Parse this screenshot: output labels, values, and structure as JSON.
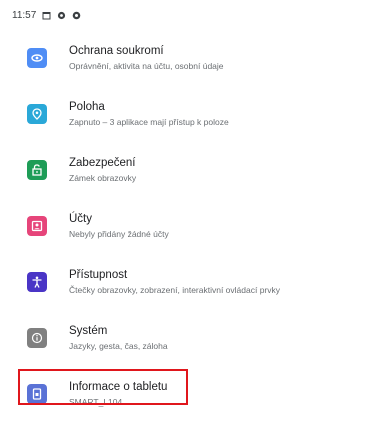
{
  "status_bar": {
    "time": "11:57",
    "icons": [
      "calendar-icon",
      "gear-icon",
      "shield-icon"
    ]
  },
  "settings": {
    "items": [
      {
        "title": "Ochrana soukromí",
        "subtitle": "Oprávnění, aktivita na účtu, osobní údaje",
        "icon": "privacy-icon",
        "color": "#4f8df5"
      },
      {
        "title": "Poloha",
        "subtitle": "Zapnuto – 3 aplikace mají přístup k poloze",
        "icon": "location-icon",
        "color": "#2aa8d8"
      },
      {
        "title": "Zabezpečení",
        "subtitle": "Zámek obrazovky",
        "icon": "lock-icon",
        "color": "#1e9d57"
      },
      {
        "title": "Účty",
        "subtitle": "Nebyly přidány žádné účty",
        "icon": "account-icon",
        "color": "#e6457a"
      },
      {
        "title": "Přístupnost",
        "subtitle": "Čtečky obrazovky, zobrazení, interaktivní ovládací prvky",
        "icon": "accessibility-icon",
        "color": "#4a35c6"
      },
      {
        "title": "Systém",
        "subtitle": "Jazyky, gesta, čas, záloha",
        "icon": "info-circle-icon",
        "color": "#808080"
      },
      {
        "title": "Informace o tabletu",
        "subtitle": "SMART_L104",
        "icon": "tablet-icon",
        "color": "#5a72d6"
      }
    ]
  },
  "highlight_color": "#e0161c"
}
